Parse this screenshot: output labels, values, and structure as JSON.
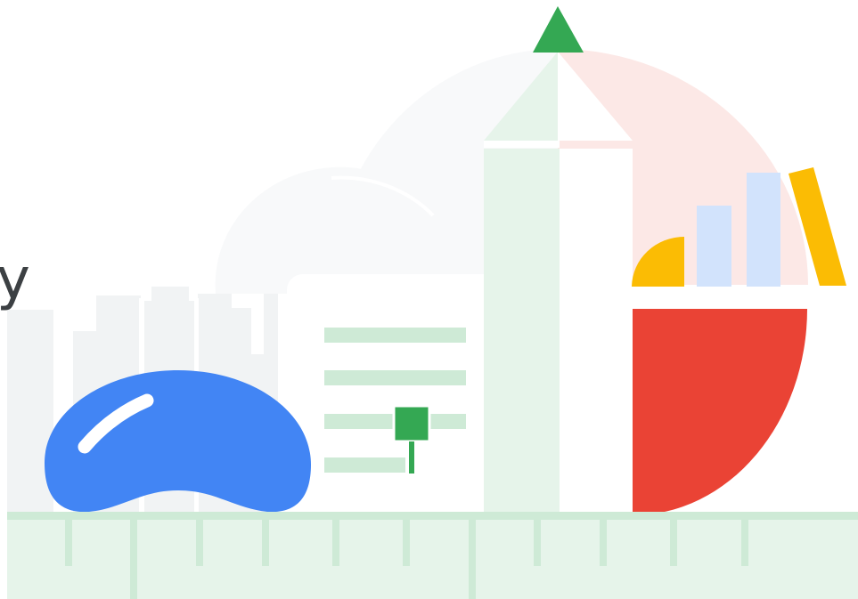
{
  "text": {
    "partial_heading": "y"
  },
  "colors": {
    "google_blue": "#4285F4",
    "google_red": "#EA4335",
    "google_yellow": "#FBBC04",
    "google_green": "#34A853",
    "light_green": "#E6F4EA",
    "mid_green": "#CEEAD6",
    "light_pink": "#FCE8E6",
    "light_blue": "#D2E3FC",
    "light_gray": "#F8F9FA",
    "building_gray": "#F1F3F4",
    "text_dark": "#3C4043"
  },
  "icons": [
    "cloud-gate-bean-icon",
    "obelisk-pencil-icon",
    "document-card-icon",
    "bar-chart-icon",
    "pie-slice-icon",
    "ruler-ground-icon"
  ]
}
